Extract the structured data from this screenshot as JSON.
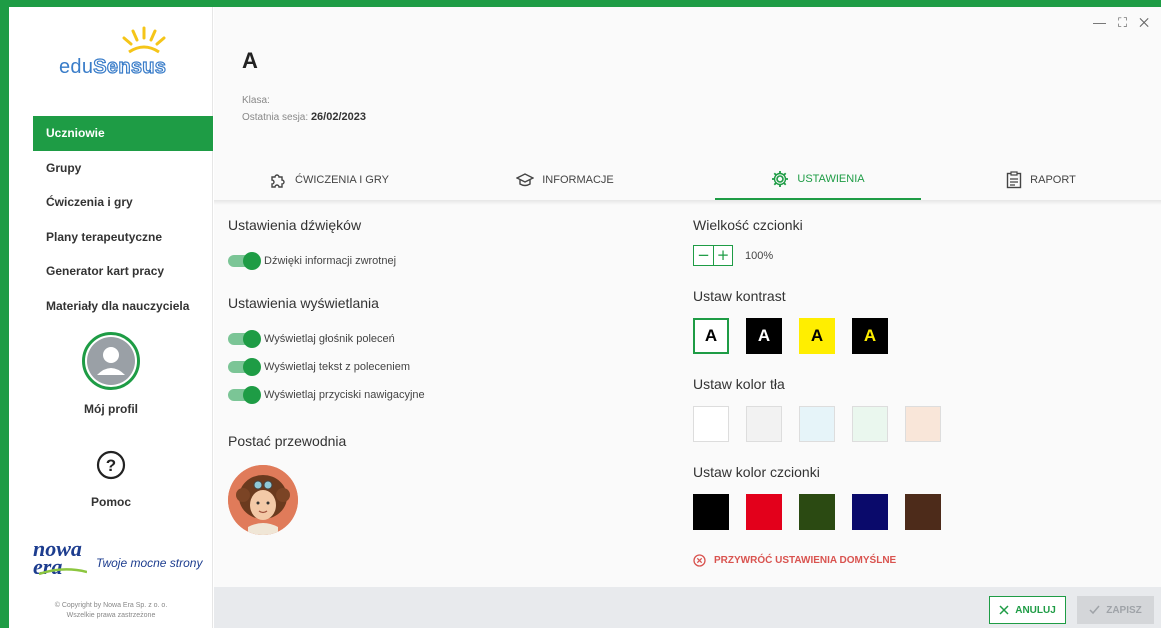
{
  "sidebar": {
    "logo_edu": "edu",
    "logo_sensus": "Sensus",
    "nav": [
      {
        "label": "Uczniowie",
        "active": true
      },
      {
        "label": "Grupy"
      },
      {
        "label": "Ćwiczenia i gry"
      },
      {
        "label": "Plany terapeutyczne"
      },
      {
        "label": "Generator kart pracy"
      },
      {
        "label": "Materiały dla nauczyciela"
      }
    ],
    "profile_label": "Mój profil",
    "help_label": "Pomoc",
    "brand_logo": "nowa era",
    "brand_slogan": "Twoje mocne strony",
    "copyright_line1": "© Copyright by Nowa Era Sp. z o. o.",
    "copyright_line2": "Wszelkie prawa zastrzeżone"
  },
  "window_controls": [
    "—",
    "⛶",
    "✕"
  ],
  "student": {
    "name": "A",
    "class_label": "Klasa:",
    "class_value": "",
    "last_session_label": "Ostatnia sesja:",
    "last_session_value": "26/02/2023"
  },
  "tabs": [
    {
      "label": "ĆWICZENIA I GRY",
      "icon": "puzzle-icon"
    },
    {
      "label": "INFORMACJE",
      "icon": "graduation-cap-icon"
    },
    {
      "label": "USTAWIENIA",
      "icon": "gear-icon",
      "active": true
    },
    {
      "label": "RAPORT",
      "icon": "clipboard-icon"
    }
  ],
  "settings": {
    "sound_title": "Ustawienia dźwięków",
    "sound_toggles": [
      {
        "label": "Dźwięki informacji zwrotnej",
        "on": true
      }
    ],
    "display_title": "Ustawienia wyświetlania",
    "display_toggles": [
      {
        "label": "Wyświetlaj głośnik poleceń",
        "on": true
      },
      {
        "label": "Wyświetlaj tekst z poleceniem",
        "on": true
      },
      {
        "label": "Wyświetlaj przyciski nawigacyjne",
        "on": true
      }
    ],
    "guide_title": "Postać przewodnia",
    "font_size_title": "Wielkość czcionki",
    "font_size_value": "100%",
    "contrast_title": "Ustaw kontrast",
    "contrast_options": [
      {
        "letter": "A",
        "bg": "#ffffff",
        "fg": "#000000",
        "selected": true
      },
      {
        "letter": "A",
        "bg": "#000000",
        "fg": "#ffffff"
      },
      {
        "letter": "A",
        "bg": "#ffee00",
        "fg": "#000000"
      },
      {
        "letter": "A",
        "bg": "#000000",
        "fg": "#ffee00"
      }
    ],
    "bg_color_title": "Ustaw kolor tła",
    "bg_colors": [
      "#ffffff",
      "#f2f2f2",
      "#e6f4f9",
      "#eaf7ee",
      "#f9e6d9"
    ],
    "font_color_title": "Ustaw kolor czcionki",
    "font_colors": [
      "#000000",
      "#e3001b",
      "#2b4a12",
      "#0a0a6b",
      "#4d2b1a"
    ],
    "reset_label": "PRZYWRÓĆ USTAWIENIA DOMYŚLNE"
  },
  "footer": {
    "cancel_label": "ANULUJ",
    "save_label": "ZAPISZ"
  },
  "colors": {
    "accent": "#1e9c45",
    "danger": "#d9534f"
  }
}
